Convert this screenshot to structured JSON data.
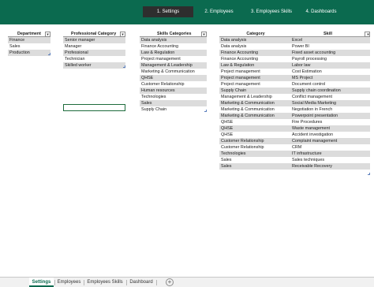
{
  "nav": {
    "buttons": [
      "1. Settings",
      "2. Employees",
      "3. Employees Skills",
      "4. Dashboards"
    ]
  },
  "department": {
    "header": "Department",
    "rows": [
      "Finance",
      "Sales",
      "Production"
    ]
  },
  "professional_category": {
    "header": "Professional Category",
    "rows": [
      "Senior manager",
      "Manager",
      "Professional",
      "Technician",
      "Skilled worker"
    ]
  },
  "skills_categories": {
    "header": "Skills Categories",
    "rows": [
      "Data analysis",
      "Finance Accounting",
      "Law & Regulation",
      "Project management",
      "Management & Leadership",
      "Marketing & Communication",
      "QHSE",
      "Customer Relationship",
      "Human resources",
      "Technologies",
      "Sales",
      "Supply Chain"
    ]
  },
  "skills": {
    "category_header": "Category",
    "skill_header": "Skill",
    "rows": [
      {
        "category": "Data analysis",
        "skill": "Excel"
      },
      {
        "category": "Data analysis",
        "skill": "Power BI"
      },
      {
        "category": "Finance Accounting",
        "skill": "Fixed asset accounting"
      },
      {
        "category": "Finance Accounting",
        "skill": "Payroll processing"
      },
      {
        "category": "Law & Regulation",
        "skill": "Labor law"
      },
      {
        "category": "Project management",
        "skill": "Cost Estimation"
      },
      {
        "category": "Project management",
        "skill": "MS Project"
      },
      {
        "category": "Project management",
        "skill": "Document control"
      },
      {
        "category": "Supply Chain",
        "skill": "Supply chain coordination"
      },
      {
        "category": "Management & Leadership",
        "skill": "Conflict management"
      },
      {
        "category": "Marketing & Communication",
        "skill": "Social Media Marketing"
      },
      {
        "category": "Marketing & Communication",
        "skill": "Negotiation in French"
      },
      {
        "category": "Marketing & Communication",
        "skill": "Powerpoint presentation"
      },
      {
        "category": "QHSE",
        "skill": "Fire Procedures"
      },
      {
        "category": "QHSE",
        "skill": "Waste management"
      },
      {
        "category": "QHSE",
        "skill": "Accident investigation"
      },
      {
        "category": "Customer Relationship",
        "skill": "Complaint management"
      },
      {
        "category": "Customer Relationship",
        "skill": "CRM"
      },
      {
        "category": "Technologies",
        "skill": "IT infrastructure"
      },
      {
        "category": "Sales",
        "skill": "Sales techniques"
      },
      {
        "category": "Sales",
        "skill": "Receivable Recovery"
      }
    ]
  },
  "sheet_tabs": [
    "Settings",
    "Employees",
    "Employees Skills",
    "Dashboard"
  ],
  "icons": {
    "filter": "filter-dropdown-icon",
    "add_sheet": "plus-circle-icon"
  },
  "colors": {
    "banner": "#0b6a4f",
    "active_nav": "#2e2e2e",
    "row_band": "#dcdcdc"
  }
}
